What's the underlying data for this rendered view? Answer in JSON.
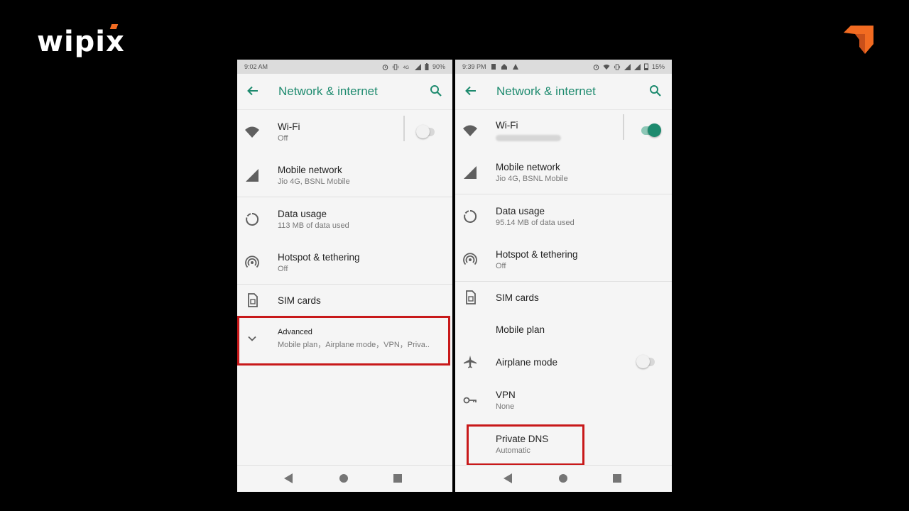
{
  "brand": {
    "logo_text": "wipix",
    "accent_color": "#f26b21"
  },
  "colors": {
    "accent": "#1d8a6e",
    "highlight": "#c8191a"
  },
  "left_phone": {
    "status": {
      "time": "9:02 AM",
      "battery": "90%"
    },
    "title": "Network & internet",
    "items": [
      {
        "label": "Wi-Fi",
        "sub": "Off",
        "icon": "wifi-icon",
        "toggle_on": false
      },
      {
        "label": "Mobile network",
        "sub": "Jio 4G, BSNL Mobile",
        "icon": "signal-icon"
      },
      {
        "label": "Data usage",
        "sub": "113 MB of data used",
        "icon": "data-usage-icon"
      },
      {
        "label": "Hotspot & tethering",
        "sub": "Off",
        "icon": "hotspot-icon"
      },
      {
        "label": "SIM cards",
        "icon": "sim-card-icon"
      },
      {
        "label": "Advanced",
        "sub": "Mobile plan，Airplane mode，VPN，Priva..",
        "icon": "chevron-down-icon"
      }
    ]
  },
  "right_phone": {
    "status": {
      "time": "9:39 PM",
      "battery": "15%"
    },
    "title": "Network & internet",
    "items": [
      {
        "label": "Wi-Fi",
        "icon": "wifi-icon",
        "toggle_on": true
      },
      {
        "label": "Mobile network",
        "sub": "Jio 4G, BSNL Mobile",
        "icon": "signal-icon"
      },
      {
        "label": "Data usage",
        "sub": "95.14 MB of data used",
        "icon": "data-usage-icon"
      },
      {
        "label": "Hotspot & tethering",
        "sub": "Off",
        "icon": "hotspot-icon"
      },
      {
        "label": "SIM cards",
        "icon": "sim-card-icon"
      },
      {
        "label": "Mobile plan"
      },
      {
        "label": "Airplane mode",
        "icon": "airplane-icon",
        "toggle_on": false
      },
      {
        "label": "VPN",
        "sub": "None",
        "icon": "vpn-key-icon"
      },
      {
        "label": "Private DNS",
        "sub": "Automatic"
      }
    ]
  }
}
